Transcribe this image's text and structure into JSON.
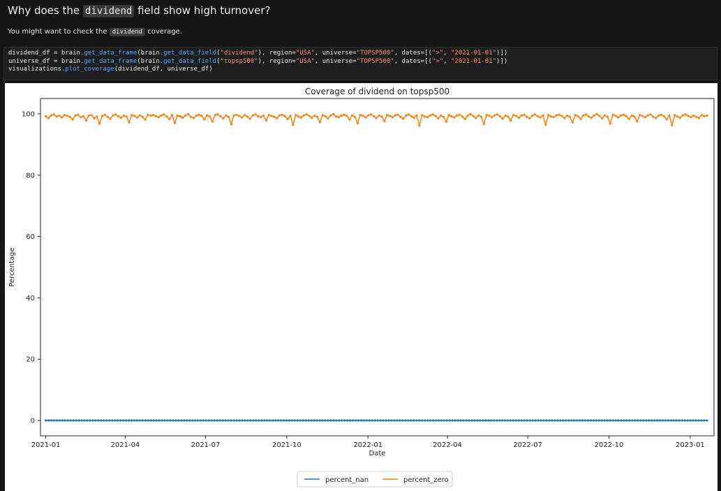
{
  "heading": {
    "before": "Why does the ",
    "code": "dividend",
    "after": " field show high turnover?"
  },
  "subline": {
    "before": "You might want to check the ",
    "code": "dividend",
    "after": " coverage."
  },
  "code_lines": [
    [
      {
        "t": "dividend_df = brain.",
        "c": "plain"
      },
      {
        "t": "get_data_frame",
        "c": "fn"
      },
      {
        "t": "(brain.",
        "c": "plain"
      },
      {
        "t": "get_data_field",
        "c": "fn"
      },
      {
        "t": "(",
        "c": "plain"
      },
      {
        "t": "\"dividend\"",
        "c": "str"
      },
      {
        "t": "), region=",
        "c": "plain"
      },
      {
        "t": "\"USA\"",
        "c": "str"
      },
      {
        "t": ", universe=",
        "c": "plain"
      },
      {
        "t": "\"TOPSP500\"",
        "c": "str"
      },
      {
        "t": ", dates=[(",
        "c": "plain"
      },
      {
        "t": "\">\"",
        "c": "str"
      },
      {
        "t": ", ",
        "c": "plain"
      },
      {
        "t": "\"2021-01-01\"",
        "c": "str"
      },
      {
        "t": ")])",
        "c": "plain"
      }
    ],
    [
      {
        "t": "universe_df = brain.",
        "c": "plain"
      },
      {
        "t": "get_data_frame",
        "c": "fn"
      },
      {
        "t": "(brain.",
        "c": "plain"
      },
      {
        "t": "get_data_field",
        "c": "fn"
      },
      {
        "t": "(",
        "c": "plain"
      },
      {
        "t": "\"topsp500\"",
        "c": "str"
      },
      {
        "t": "), region=",
        "c": "plain"
      },
      {
        "t": "\"USA\"",
        "c": "str"
      },
      {
        "t": ", universe=",
        "c": "plain"
      },
      {
        "t": "\"TOPSP500\"",
        "c": "str"
      },
      {
        "t": ", dates=[(",
        "c": "plain"
      },
      {
        "t": "\">\"",
        "c": "str"
      },
      {
        "t": ", ",
        "c": "plain"
      },
      {
        "t": "\"2021-01-01\"",
        "c": "str"
      },
      {
        "t": ")])",
        "c": "plain"
      }
    ],
    [
      {
        "t": "visualizations.",
        "c": "plain"
      },
      {
        "t": "plot_coverage",
        "c": "fn"
      },
      {
        "t": "(dividend_df, universe_df)",
        "c": "plain"
      }
    ]
  ],
  "colors": {
    "percent_nan": "#1f77b4",
    "percent_zero": "#ff7f0e",
    "code_fn": "#4fa3ff",
    "code_str": "#ff8a7a"
  },
  "chart_data": {
    "type": "line",
    "title": "Coverage of dividend on topsp500",
    "xlabel": "Date",
    "ylabel": "Percentage",
    "x_range": [
      "2021-01-01",
      "2023-01-20"
    ],
    "ylim": [
      -5,
      105
    ],
    "y_ticks": [
      0,
      20,
      40,
      60,
      80,
      100
    ],
    "x_ticks": [
      "2021-01",
      "2021-04",
      "2021-07",
      "2021-10",
      "2022-01",
      "2022-04",
      "2022-07",
      "2022-10",
      "2023-01"
    ],
    "grid": false,
    "legend_position": "bottom-center",
    "markers": true,
    "series": [
      {
        "name": "percent_nan",
        "color": "#1f77b4",
        "values": [
          0,
          0,
          0,
          0,
          0,
          0,
          0,
          0,
          0,
          0,
          0,
          0,
          0,
          0,
          0,
          0,
          0,
          0,
          0,
          0,
          0,
          0,
          0,
          0,
          0,
          0,
          0,
          0,
          0,
          0,
          0,
          0,
          0,
          0,
          0,
          0,
          0,
          0,
          0,
          0,
          0,
          0,
          0,
          0,
          0,
          0,
          0,
          0,
          0,
          0,
          0,
          0,
          0,
          0,
          0,
          0,
          0,
          0,
          0,
          0,
          0,
          0,
          0,
          0,
          0,
          0,
          0,
          0,
          0,
          0,
          0,
          0,
          0,
          0,
          0,
          0,
          0,
          0,
          0,
          0,
          0,
          0,
          0,
          0,
          0,
          0,
          0,
          0,
          0,
          0,
          0,
          0,
          0,
          0,
          0,
          0,
          0,
          0,
          0,
          0,
          0,
          0,
          0,
          0,
          0,
          0,
          0,
          0,
          0,
          0,
          0,
          0,
          0,
          0,
          0,
          0,
          0,
          0,
          0,
          0,
          0,
          0,
          0,
          0,
          0,
          0,
          0,
          0,
          0,
          0,
          0,
          0,
          0,
          0,
          0,
          0,
          0,
          0,
          0,
          0,
          0,
          0,
          0,
          0,
          0,
          0,
          0,
          0,
          0,
          0,
          0,
          0,
          0,
          0,
          0,
          0,
          0,
          0,
          0,
          0,
          0,
          0,
          0,
          0,
          0,
          0,
          0,
          0,
          0,
          0,
          0,
          0,
          0,
          0,
          0,
          0,
          0,
          0,
          0,
          0,
          0,
          0,
          0,
          0,
          0,
          0,
          0,
          0,
          0,
          0,
          0,
          0,
          0,
          0,
          0,
          0,
          0,
          0,
          0,
          0,
          0,
          0,
          0,
          0,
          0,
          0,
          0,
          0,
          0,
          0,
          0,
          0,
          0,
          0,
          0,
          0,
          0,
          0,
          0,
          0,
          0,
          0,
          0,
          0,
          0,
          0,
          0,
          0,
          0,
          0,
          0,
          0,
          0,
          0,
          0,
          0,
          0,
          0,
          0,
          0
        ]
      },
      {
        "name": "percent_zero",
        "color": "#ff7f0e",
        "values": [
          99.2,
          98.6,
          99.5,
          99.8,
          99.1,
          99.4,
          98.8,
          99.6,
          99.3,
          99.0,
          98.2,
          99.5,
          99.7,
          98.9,
          99.2,
          97.8,
          99.4,
          99.6,
          98.5,
          99.1,
          96.8,
          99.3,
          99.7,
          99.0,
          98.4,
          99.5,
          99.8,
          99.2,
          98.7,
          99.4,
          99.1,
          97.2,
          99.6,
          99.3,
          98.8,
          99.5,
          99.0,
          98.1,
          99.7,
          99.4,
          99.6,
          99.2,
          98.9,
          99.5,
          99.8,
          99.1,
          98.3,
          99.6,
          97.0,
          99.4,
          99.2,
          98.7,
          99.5,
          99.9,
          99.0,
          98.6,
          99.4,
          99.7,
          99.3,
          98.2,
          99.5,
          99.1,
          97.5,
          99.6,
          99.8,
          99.2,
          98.5,
          99.4,
          99.0,
          96.6,
          99.5,
          99.7,
          99.3,
          98.8,
          99.6,
          99.1,
          98.4,
          99.5,
          99.8,
          99.2,
          98.9,
          99.4,
          97.9,
          99.6,
          99.3,
          99.0,
          98.6,
          99.5,
          99.7,
          99.2,
          98.3,
          99.4,
          96.4,
          99.6,
          99.1,
          98.8,
          99.5,
          99.8,
          99.3,
          98.7,
          99.4,
          99.0,
          97.3,
          99.6,
          99.2,
          98.5,
          99.5,
          99.9,
          99.1,
          98.9,
          99.4,
          99.7,
          99.3,
          98.2,
          99.5,
          99.0,
          96.9,
          99.6,
          99.4,
          98.8,
          99.5,
          99.8,
          99.2,
          98.6,
          99.4,
          99.1,
          97.6,
          99.6,
          99.3,
          98.9,
          99.5,
          99.7,
          99.0,
          98.4,
          99.4,
          99.8,
          99.2,
          98.7,
          99.5,
          96.2,
          99.6,
          99.1,
          98.9,
          99.5,
          99.8,
          99.3,
          98.5,
          99.4,
          99.0,
          97.4,
          99.6,
          99.2,
          98.8,
          99.5,
          99.7,
          99.1,
          98.3,
          99.4,
          99.9,
          99.3,
          98.6,
          99.5,
          99.0,
          96.7,
          99.6,
          99.4,
          98.9,
          99.5,
          99.8,
          99.2,
          98.4,
          99.4,
          99.1,
          97.8,
          99.6,
          99.3,
          98.7,
          99.5,
          99.7,
          99.0,
          98.5,
          99.4,
          99.8,
          99.2,
          98.8,
          99.5,
          96.5,
          99.6,
          99.1,
          98.9,
          99.5,
          99.7,
          99.3,
          98.6,
          99.4,
          99.0,
          97.2,
          99.6,
          99.2,
          98.3,
          99.5,
          99.8,
          99.1,
          98.7,
          99.4,
          99.9,
          99.3,
          98.5,
          99.5,
          99.0,
          96.8,
          99.6,
          99.4,
          98.8,
          99.5,
          99.7,
          99.2,
          98.4,
          99.4,
          99.1,
          97.5,
          99.6,
          99.3,
          98.9,
          99.5,
          99.8,
          99.0,
          98.6,
          99.4,
          99.7,
          99.2,
          98.2,
          99.5,
          96.3,
          99.6,
          99.1,
          98.7,
          99.5,
          99.8,
          99.3,
          98.9,
          99.4,
          99.0,
          98.6,
          99.6,
          99.2,
          99.4
        ]
      }
    ]
  }
}
